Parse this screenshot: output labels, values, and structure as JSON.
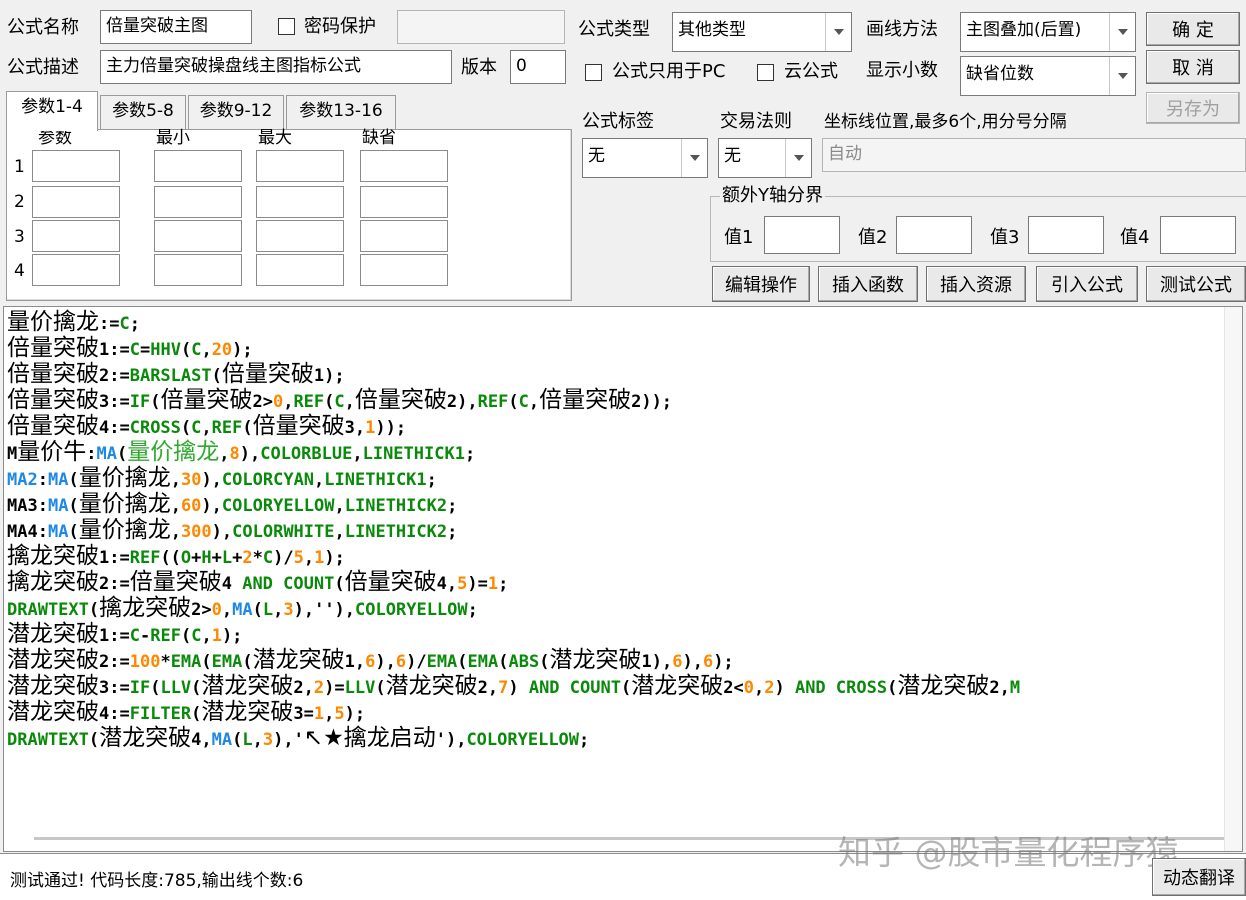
{
  "form": {
    "name_label": "公式名称",
    "name_value": "倍量突破主图",
    "password_label": "密码保护",
    "desc_label": "公式描述",
    "desc_value": "主力倍量突破操盘线主图指标公式",
    "version_label": "版本",
    "version_value": "0",
    "type_label": "公式类型",
    "type_value": "其他类型",
    "draw_label": "画线方法",
    "draw_value": "主图叠加(后置)",
    "pc_only_label": "公式只用于PC",
    "cloud_label": "云公式",
    "decimals_label": "显示小数",
    "decimals_value": "缺省位数",
    "tag_label": "公式标签",
    "tag_value": "无",
    "rule_label": "交易法则",
    "rule_value": "无",
    "axis_label": "坐标线位置,最多6个,用分号分隔",
    "axis_placeholder": "自动",
    "yaxis_title": "额外Y轴分界",
    "v1": "值1",
    "v2": "值2",
    "v3": "值3",
    "v4": "值4"
  },
  "buttons": {
    "ok": "确 定",
    "cancel": "取 消",
    "saveas": "另存为",
    "edit": "编辑操作",
    "insert_fn": "插入函数",
    "insert_res": "插入资源",
    "import": "引入公式",
    "test": "测试公式",
    "translate": "动态翻译"
  },
  "tabs": [
    "参数1-4",
    "参数5-8",
    "参数9-12",
    "参数13-16"
  ],
  "params": {
    "headers": [
      "参数",
      "最小",
      "最大",
      "缺省"
    ],
    "rows": [
      "1",
      "2",
      "3",
      "4"
    ]
  },
  "code": [
    [
      [
        "量价擒龙",
        "s",
        "cn"
      ],
      [
        ":=",
        "s"
      ],
      [
        "C",
        "k"
      ],
      [
        ";",
        "s"
      ]
    ],
    [
      [
        "倍量突破",
        "s",
        "cn"
      ],
      [
        "1:=",
        "s"
      ],
      [
        "C",
        "k"
      ],
      [
        "=",
        "s"
      ],
      [
        "HHV",
        "k"
      ],
      [
        "(",
        "s"
      ],
      [
        "C",
        "k"
      ],
      [
        ",",
        "s"
      ],
      [
        "20",
        "n"
      ],
      [
        ");",
        "s"
      ]
    ],
    [
      [
        "倍量突破",
        "s",
        "cn"
      ],
      [
        "2:=",
        "s"
      ],
      [
        "BARSLAST",
        "k"
      ],
      [
        "(",
        "s"
      ],
      [
        "倍量突破",
        "s",
        "cn"
      ],
      [
        "1);",
        "s"
      ]
    ],
    [
      [
        "倍量突破",
        "s",
        "cn"
      ],
      [
        "3:=",
        "s"
      ],
      [
        "IF",
        "k"
      ],
      [
        "(",
        "s"
      ],
      [
        "倍量突破",
        "s",
        "cn"
      ],
      [
        "2>",
        "s"
      ],
      [
        "0",
        "n"
      ],
      [
        ",",
        "s"
      ],
      [
        "REF",
        "k"
      ],
      [
        "(",
        "s"
      ],
      [
        "C",
        "k"
      ],
      [
        ",",
        "s"
      ],
      [
        "倍量突破",
        "s",
        "cn"
      ],
      [
        "2),",
        "s"
      ],
      [
        "REF",
        "k"
      ],
      [
        "(",
        "s"
      ],
      [
        "C",
        "k"
      ],
      [
        ",",
        "s"
      ],
      [
        "倍量突破",
        "s",
        "cn"
      ],
      [
        "2));",
        "s"
      ]
    ],
    [
      [
        "倍量突破",
        "s",
        "cn"
      ],
      [
        "4:=",
        "s"
      ],
      [
        "CROSS",
        "k"
      ],
      [
        "(",
        "s"
      ],
      [
        "C",
        "k"
      ],
      [
        ",",
        "s"
      ],
      [
        "REF",
        "k"
      ],
      [
        "(",
        "s"
      ],
      [
        "倍量突破",
        "s",
        "cn"
      ],
      [
        "3,",
        "s"
      ],
      [
        "1",
        "n"
      ],
      [
        "));",
        "s"
      ]
    ],
    [
      [
        "M",
        "s"
      ],
      [
        "量价牛",
        "s",
        "cn"
      ],
      [
        ":",
        "s"
      ],
      [
        "MA",
        "b"
      ],
      [
        "(",
        "s"
      ],
      [
        "量价擒龙",
        "g",
        "cn"
      ],
      [
        ",",
        "s"
      ],
      [
        "8",
        "n"
      ],
      [
        "),",
        "s"
      ],
      [
        "COLORBLUE",
        "k"
      ],
      [
        ",",
        "s"
      ],
      [
        "LINETHICK1",
        "k"
      ],
      [
        ";",
        "s"
      ]
    ],
    [
      [
        "MA2",
        "b"
      ],
      [
        ":",
        "s"
      ],
      [
        "MA",
        "b"
      ],
      [
        "(",
        "s"
      ],
      [
        "量价擒龙",
        "s",
        "cn"
      ],
      [
        ",",
        "s"
      ],
      [
        "30",
        "n"
      ],
      [
        "),",
        "s"
      ],
      [
        "COLORCYAN",
        "k"
      ],
      [
        ",",
        "s"
      ],
      [
        "LINETHICK1",
        "k"
      ],
      [
        ";",
        "s"
      ]
    ],
    [
      [
        "MA3:",
        "s"
      ],
      [
        "MA",
        "b"
      ],
      [
        "(",
        "s"
      ],
      [
        "量价擒龙",
        "s",
        "cn"
      ],
      [
        ",",
        "s"
      ],
      [
        "60",
        "n"
      ],
      [
        "),",
        "s"
      ],
      [
        "COLORYELLOW",
        "k"
      ],
      [
        ",",
        "s"
      ],
      [
        "LINETHICK2",
        "k"
      ],
      [
        ";",
        "s"
      ]
    ],
    [
      [
        "MA4:",
        "s"
      ],
      [
        "MA",
        "b"
      ],
      [
        "(",
        "s"
      ],
      [
        "量价擒龙",
        "s",
        "cn"
      ],
      [
        ",",
        "s"
      ],
      [
        "300",
        "n"
      ],
      [
        "),",
        "s"
      ],
      [
        "COLORWHITE",
        "k"
      ],
      [
        ",",
        "s"
      ],
      [
        "LINETHICK2",
        "k"
      ],
      [
        ";",
        "s"
      ]
    ],
    [
      [
        "擒龙突破",
        "s",
        "cn"
      ],
      [
        "1:=",
        "s"
      ],
      [
        "REF",
        "k"
      ],
      [
        "((",
        "s"
      ],
      [
        "O",
        "k"
      ],
      [
        "+",
        "s"
      ],
      [
        "H",
        "k"
      ],
      [
        "+",
        "s"
      ],
      [
        "L",
        "k"
      ],
      [
        "+",
        "s"
      ],
      [
        "2",
        "n"
      ],
      [
        "*",
        "s"
      ],
      [
        "C",
        "k"
      ],
      [
        ")/",
        "s"
      ],
      [
        "5",
        "n"
      ],
      [
        ",",
        "s"
      ],
      [
        "1",
        "n"
      ],
      [
        ");",
        "s"
      ]
    ],
    [
      [
        "擒龙突破",
        "s",
        "cn"
      ],
      [
        "2:=",
        "s"
      ],
      [
        "倍量突破",
        "s",
        "cn"
      ],
      [
        "4 ",
        "s"
      ],
      [
        "AND",
        "k"
      ],
      [
        " ",
        "s"
      ],
      [
        "COUNT",
        "k"
      ],
      [
        "(",
        "s"
      ],
      [
        "倍量突破",
        "s",
        "cn"
      ],
      [
        "4,",
        "s"
      ],
      [
        "5",
        "n"
      ],
      [
        ")=",
        "s"
      ],
      [
        "1",
        "n"
      ],
      [
        ";",
        "s"
      ]
    ],
    [
      [
        "DRAWTEXT",
        "k"
      ],
      [
        "(",
        "s"
      ],
      [
        "擒龙突破",
        "s",
        "cn"
      ],
      [
        "2>",
        "s"
      ],
      [
        "0",
        "n"
      ],
      [
        ",",
        "s"
      ],
      [
        "MA",
        "b"
      ],
      [
        "(",
        "s"
      ],
      [
        "L",
        "k"
      ],
      [
        ",",
        "s"
      ],
      [
        "3",
        "n"
      ],
      [
        "),'')",
        "s"
      ],
      [
        ",",
        "s"
      ],
      [
        "COLORYELLOW",
        "k"
      ],
      [
        ";",
        "s"
      ]
    ],
    [
      [
        "潜龙突破",
        "s",
        "cn"
      ],
      [
        "1:=",
        "s"
      ],
      [
        "C",
        "k"
      ],
      [
        "-",
        "s"
      ],
      [
        "REF",
        "k"
      ],
      [
        "(",
        "s"
      ],
      [
        "C",
        "k"
      ],
      [
        ",",
        "s"
      ],
      [
        "1",
        "n"
      ],
      [
        ");",
        "s"
      ]
    ],
    [
      [
        "潜龙突破",
        "s",
        "cn"
      ],
      [
        "2:=",
        "s"
      ],
      [
        "100",
        "n"
      ],
      [
        "*",
        "s"
      ],
      [
        "EMA",
        "k"
      ],
      [
        "(",
        "s"
      ],
      [
        "EMA",
        "k"
      ],
      [
        "(",
        "s"
      ],
      [
        "潜龙突破",
        "s",
        "cn"
      ],
      [
        "1,",
        "s"
      ],
      [
        "6",
        "n"
      ],
      [
        "),",
        "s"
      ],
      [
        "6",
        "n"
      ],
      [
        ")/",
        "s"
      ],
      [
        "EMA",
        "k"
      ],
      [
        "(",
        "s"
      ],
      [
        "EMA",
        "k"
      ],
      [
        "(",
        "s"
      ],
      [
        "ABS",
        "k"
      ],
      [
        "(",
        "s"
      ],
      [
        "潜龙突破",
        "s",
        "cn"
      ],
      [
        "1),",
        "s"
      ],
      [
        "6",
        "n"
      ],
      [
        "),",
        "s"
      ],
      [
        "6",
        "n"
      ],
      [
        ");",
        "s"
      ]
    ],
    [
      [
        "潜龙突破",
        "s",
        "cn"
      ],
      [
        "3:=",
        "s"
      ],
      [
        "IF",
        "k"
      ],
      [
        "(",
        "s"
      ],
      [
        "LLV",
        "k"
      ],
      [
        "(",
        "s"
      ],
      [
        "潜龙突破",
        "s",
        "cn"
      ],
      [
        "2,",
        "s"
      ],
      [
        "2",
        "n"
      ],
      [
        ")=",
        "s"
      ],
      [
        "LLV",
        "k"
      ],
      [
        "(",
        "s"
      ],
      [
        "潜龙突破",
        "s",
        "cn"
      ],
      [
        "2,",
        "s"
      ],
      [
        "7",
        "n"
      ],
      [
        ") ",
        "s"
      ],
      [
        "AND",
        "k"
      ],
      [
        " ",
        "s"
      ],
      [
        "COUNT",
        "k"
      ],
      [
        "(",
        "s"
      ],
      [
        "潜龙突破",
        "s",
        "cn"
      ],
      [
        "2<",
        "s"
      ],
      [
        "0",
        "n"
      ],
      [
        ",",
        "s"
      ],
      [
        "2",
        "n"
      ],
      [
        ") ",
        "s"
      ],
      [
        "AND",
        "k"
      ],
      [
        " ",
        "s"
      ],
      [
        "CROSS",
        "k"
      ],
      [
        "(",
        "s"
      ],
      [
        "潜龙突破",
        "s",
        "cn"
      ],
      [
        "2,",
        "s"
      ],
      [
        "M",
        "k"
      ]
    ],
    [
      [
        "潜龙突破",
        "s",
        "cn"
      ],
      [
        "4:=",
        "s"
      ],
      [
        "FILTER",
        "k"
      ],
      [
        "(",
        "s"
      ],
      [
        "潜龙突破",
        "s",
        "cn"
      ],
      [
        "3=",
        "s"
      ],
      [
        "1",
        "n"
      ],
      [
        ",",
        "s"
      ],
      [
        "5",
        "n"
      ],
      [
        ");",
        "s"
      ]
    ],
    [
      [
        "DRAWTEXT",
        "k"
      ],
      [
        "(",
        "s"
      ],
      [
        "潜龙突破",
        "s",
        "cn"
      ],
      [
        "4,",
        "s"
      ],
      [
        "MA",
        "b"
      ],
      [
        "(",
        "s"
      ],
      [
        "L",
        "k"
      ],
      [
        ",",
        "s"
      ],
      [
        "3",
        "n"
      ],
      [
        "),'",
        "s"
      ],
      [
        "↖★擒龙启动",
        "s",
        "cn"
      ],
      [
        "'),",
        "s"
      ],
      [
        "COLORYELLOW",
        "k"
      ],
      [
        ";",
        "s"
      ]
    ]
  ],
  "status": "测试通过! 代码长度:785,输出线个数:6",
  "watermark": "知乎 @股市量化程序猿"
}
